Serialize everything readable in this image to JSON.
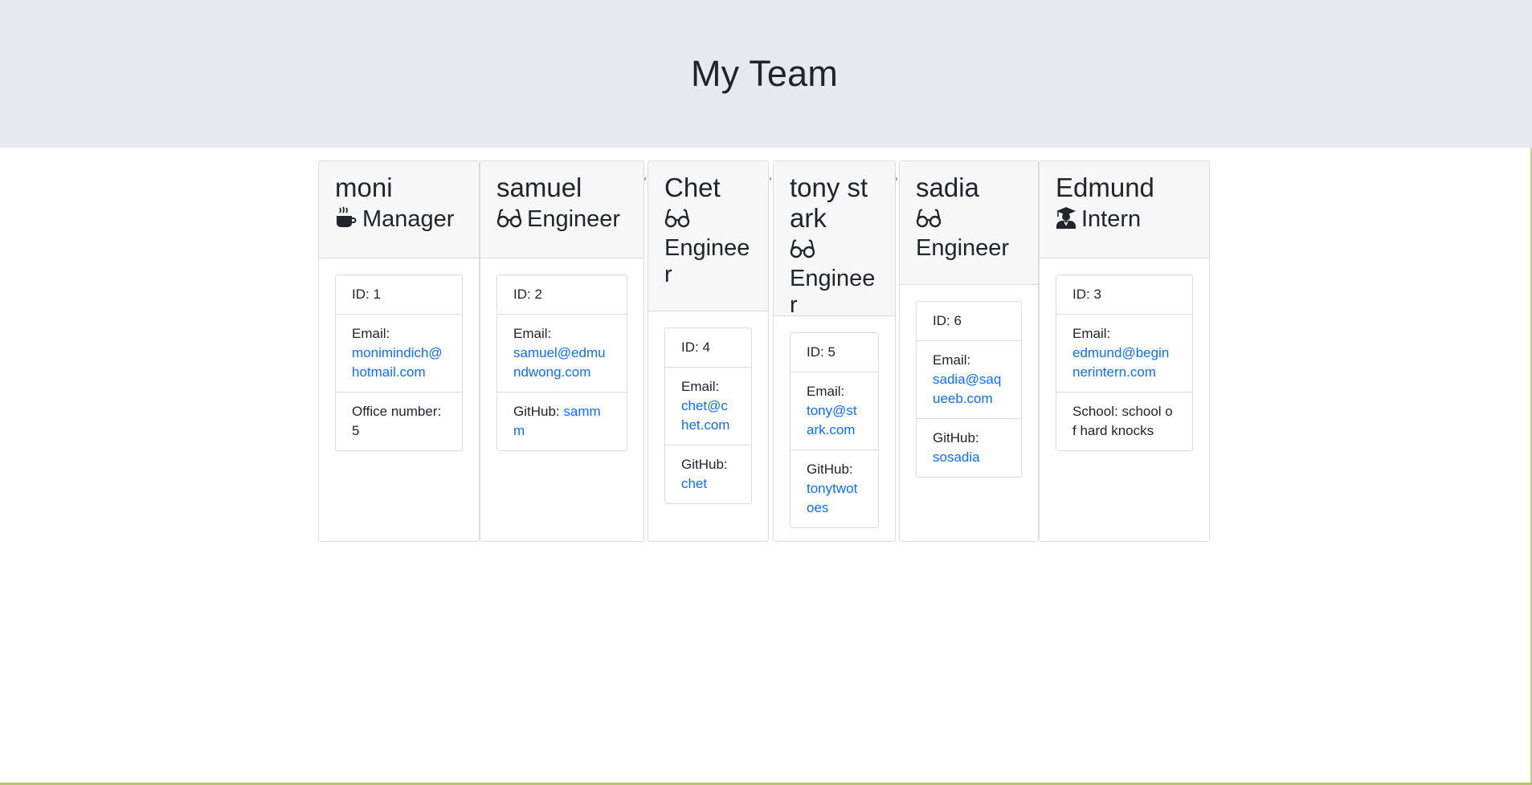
{
  "header": {
    "title": "My Team"
  },
  "cards": [
    {
      "name": "moni",
      "role": "Manager",
      "role_icon": "coffee-icon",
      "id_label": "ID: ",
      "id": "1",
      "email_label": "Email:",
      "email": "monimindich@hotmail.com",
      "extra_label": "Office number:",
      "extra_value": "5"
    },
    {
      "name": "samuel",
      "role": "Engineer",
      "role_icon": "glasses-icon",
      "id_label": "ID: ",
      "id": "2",
      "email_label": "Email:",
      "email": "samuel@edmundwong.com",
      "extra_label": "GitHub: ",
      "extra_value": "sammm"
    },
    {
      "name": "Chet",
      "role": "Engineer",
      "role_icon": "glasses-icon",
      "id_label": "ID: ",
      "id": "4",
      "email_label": "Email:",
      "email": "chet@chet.com",
      "extra_label": "GitHub:",
      "extra_value": "chet"
    },
    {
      "name": "tony stark",
      "role": "Engineer",
      "role_icon": "glasses-icon",
      "id_label": "ID: ",
      "id": "5",
      "email_label": "Email:",
      "email": "tony@stark.com",
      "extra_label": "GitHub:",
      "extra_value": "tonytwotoes"
    },
    {
      "name": "sadia",
      "role": "Engineer",
      "role_icon": "glasses-icon",
      "id_label": "ID: ",
      "id": "6",
      "email_label": "Email:",
      "email": "sadia@saqueeb.com",
      "extra_label": "GitHub:",
      "extra_value": "sosadia"
    },
    {
      "name": "Edmund",
      "role": "Intern",
      "role_icon": "graduate-icon",
      "id_label": "ID: ",
      "id": "3",
      "email_label": "Email:",
      "email": "edmund@beginnerintern.com",
      "extra_label": "School: ",
      "extra_value": "school of hard knocks"
    }
  ],
  "separator_char": ","
}
